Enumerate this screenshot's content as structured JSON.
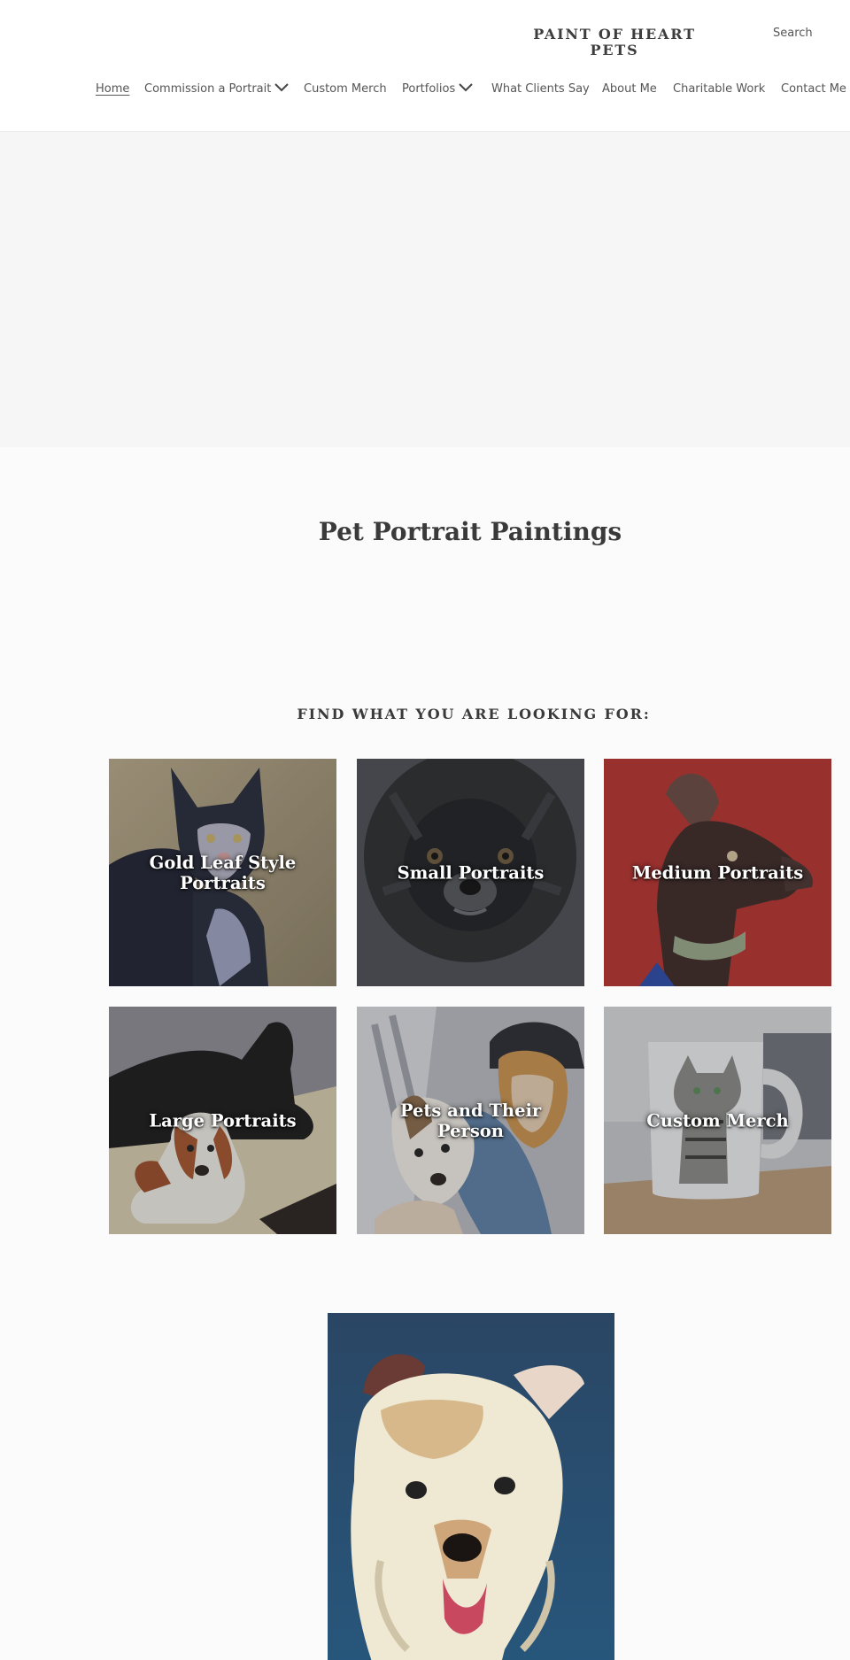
{
  "header": {
    "site_title": "PAINT OF HEART PETS",
    "search_label": "Search",
    "nav": [
      {
        "label": "Home",
        "active": true
      },
      {
        "label": "Commission a Portrait",
        "has_dropdown": true
      },
      {
        "label": "Custom Merch"
      },
      {
        "label": "Portfolios",
        "has_dropdown": true
      },
      {
        "label": "What Clients Say"
      },
      {
        "label": "About Me"
      },
      {
        "label": "Charitable Work"
      },
      {
        "label": "Contact Me"
      }
    ]
  },
  "main": {
    "page_title": "Pet Portrait Paintings",
    "section_heading": "FIND WHAT YOU ARE LOOKING FOR:",
    "tiles": [
      {
        "label": "Gold Leaf Style Portraits",
        "image": "black-white-cat-on-gold-leaf"
      },
      {
        "label": "Small Portraits",
        "image": "black-pomeranian"
      },
      {
        "label": "Medium Portraits",
        "image": "brown-dog-on-red"
      },
      {
        "label": "Large Portraits",
        "image": "black-lab-and-beagle"
      },
      {
        "label": "Pets and Their Person",
        "image": "person-hugging-dog"
      },
      {
        "label": "Custom Merch",
        "image": "mug-with-tabby-cat"
      }
    ],
    "feature_image": "terrier-on-blue-painting"
  },
  "colors": {
    "text": "#3a3a3a",
    "nav_text": "#555555",
    "hero_bg": "#f6f6f6",
    "page_bg": "#fbfbfb"
  }
}
